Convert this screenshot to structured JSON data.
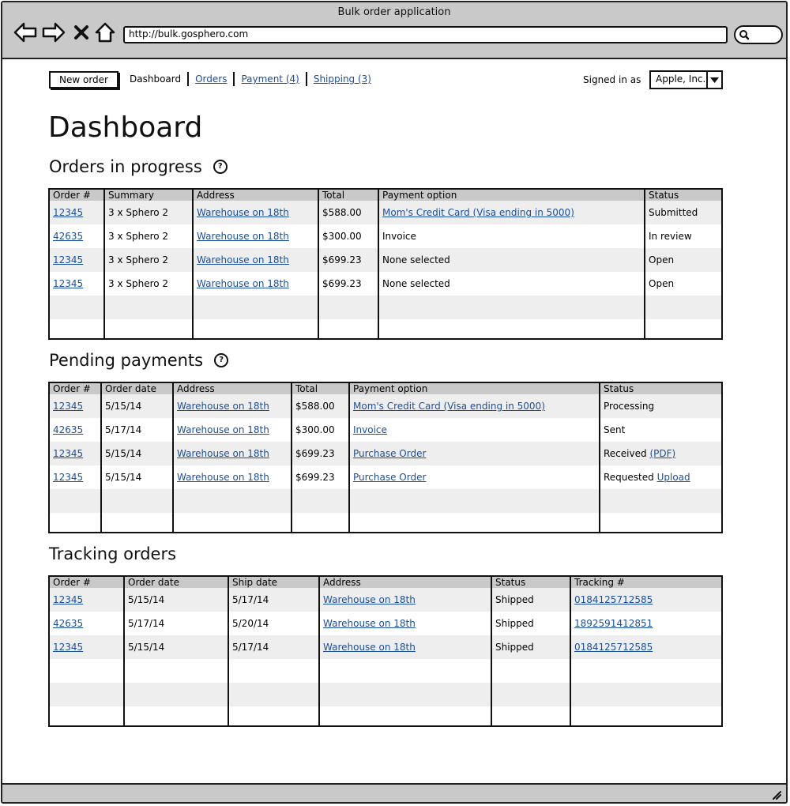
{
  "window": {
    "title": "Bulk order application",
    "url": "http://bulk.gosphero.com"
  },
  "toolbar": {
    "new_order_label": "New order",
    "tabs": [
      {
        "label": "Dashboard",
        "link": false
      },
      {
        "label": "Orders",
        "link": true
      },
      {
        "label": "Payment (4)",
        "link": true
      },
      {
        "label": "Shipping (3)",
        "link": true
      }
    ],
    "signed_in_label": "Signed in as",
    "account": "Apple, Inc."
  },
  "page_title": "Dashboard",
  "orders_in_progress": {
    "title": "Orders in progress",
    "help": "?",
    "columns": [
      "Order #",
      "Summary",
      "Address",
      "Total",
      "Payment option",
      "Status"
    ],
    "rows": [
      {
        "order": "12345",
        "summary": "3 x Sphero 2",
        "address": "Warehouse on 18th",
        "total": "$588.00",
        "payment": "Mom's Credit Card (Visa ending in 5000)",
        "payment_link": true,
        "status": "Submitted"
      },
      {
        "order": "42635",
        "summary": "3 x Sphero 2",
        "address": "Warehouse on 18th",
        "total": "$300.00",
        "payment": "Invoice",
        "payment_link": false,
        "status": "In review"
      },
      {
        "order": "12345",
        "summary": "3 x Sphero 2",
        "address": "Warehouse on 18th",
        "total": "$699.23",
        "payment": "None selected",
        "payment_link": false,
        "status": "Open"
      },
      {
        "order": "12345",
        "summary": "3 x Sphero 2",
        "address": "Warehouse on 18th",
        "total": "$699.23",
        "payment": "None selected",
        "payment_link": false,
        "status": "Open"
      }
    ]
  },
  "pending_payments": {
    "title": "Pending payments",
    "help": "?",
    "columns": [
      "Order #",
      "Order date",
      "Address",
      "Total",
      "Payment option",
      "Status"
    ],
    "rows": [
      {
        "order": "12345",
        "date": "5/15/14",
        "address": "Warehouse on 18th",
        "total": "$588.00",
        "payment": "Mom's Credit Card (Visa ending in 5000)",
        "status": "Processing",
        "status_link": ""
      },
      {
        "order": "42635",
        "date": "5/17/14",
        "address": "Warehouse on 18th",
        "total": "$300.00",
        "payment": "Invoice",
        "status": "Sent",
        "status_link": ""
      },
      {
        "order": "12345",
        "date": "5/15/14",
        "address": "Warehouse on 18th",
        "total": "$699.23",
        "payment": "Purchase Order",
        "status": "Received",
        "status_link": "(PDF)"
      },
      {
        "order": "12345",
        "date": "5/15/14",
        "address": "Warehouse on 18th",
        "total": "$699.23",
        "payment": "Purchase Order",
        "status": "Requested",
        "status_link": "Upload"
      }
    ]
  },
  "tracking_orders": {
    "title": "Tracking orders",
    "columns": [
      "Order #",
      "Order date",
      "Ship date",
      "Address",
      "Status",
      "Tracking #"
    ],
    "rows": [
      {
        "order": "12345",
        "date": "5/15/14",
        "ship": "5/17/14",
        "address": "Warehouse on 18th",
        "status": "Shipped",
        "tracking": "0184125712585"
      },
      {
        "order": "42635",
        "date": "5/17/14",
        "ship": "5/20/14",
        "address": "Warehouse on 18th",
        "status": "Shipped",
        "tracking": "1892591412851"
      },
      {
        "order": "12345",
        "date": "5/15/14",
        "ship": "5/17/14",
        "address": "Warehouse on 18th",
        "status": "Shipped",
        "tracking": "0184125712585"
      }
    ]
  },
  "icons": {
    "back": "back-arrow-icon",
    "forward": "forward-arrow-icon",
    "stop": "close-icon",
    "home": "home-icon",
    "search": "search-icon",
    "dropdown": "chevron-down-icon",
    "resize": "resize-grip-icon"
  },
  "colors": {
    "link": "#1a4f9c",
    "chrome": "#c9c9c9",
    "row_alt": "#eeeeee"
  }
}
